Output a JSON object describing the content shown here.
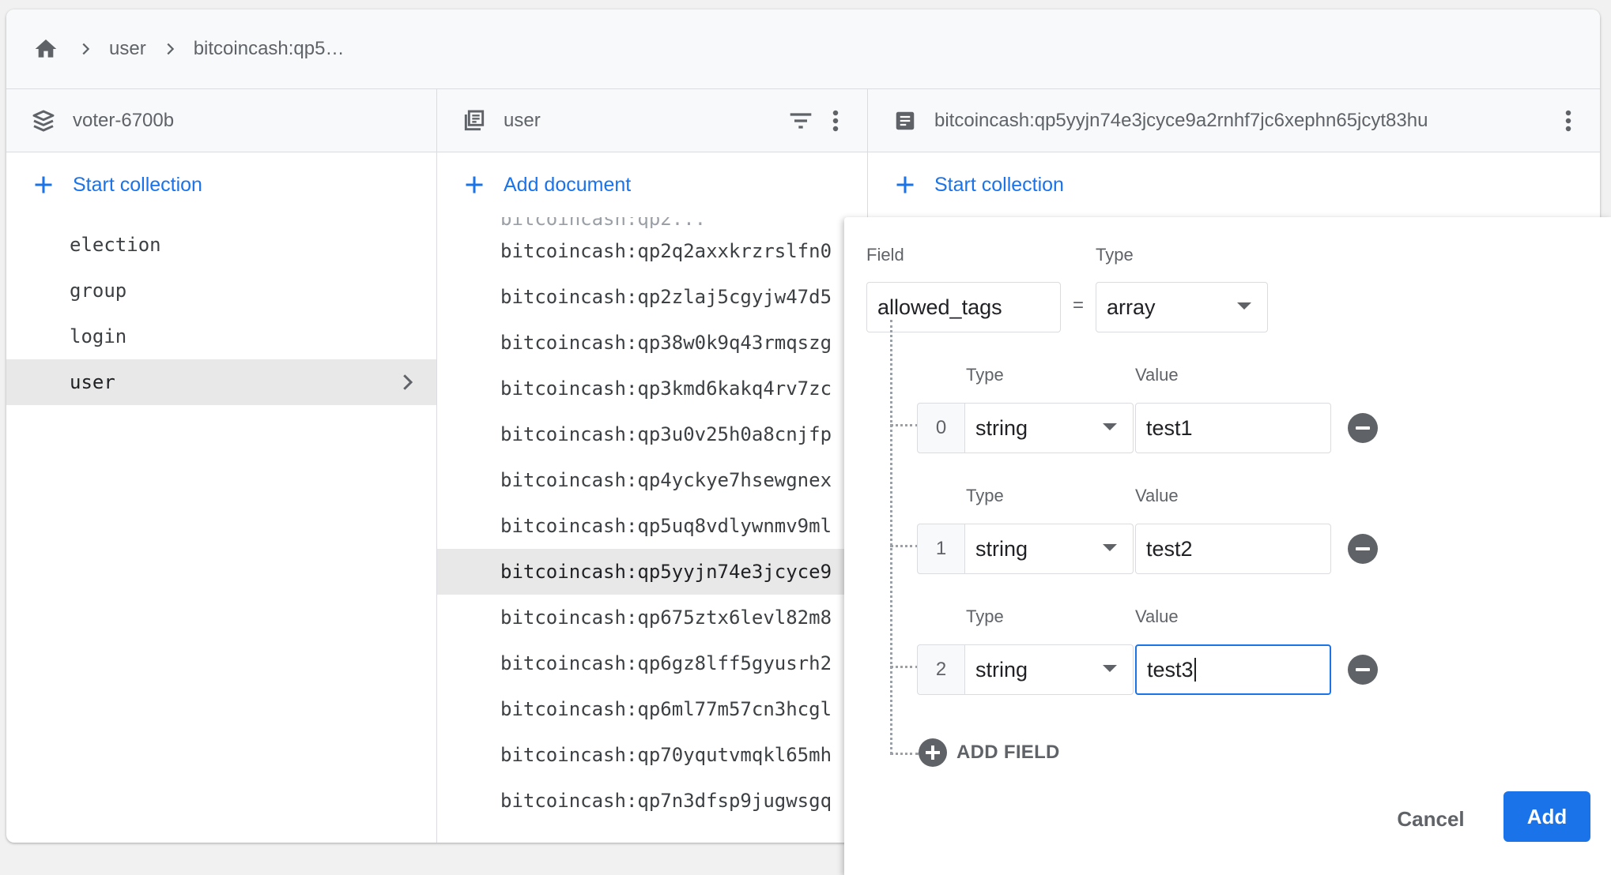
{
  "breadcrumb": {
    "items": [
      "user",
      "bitcoincash:qp5…"
    ]
  },
  "columns": {
    "project": {
      "title": "voter-6700b",
      "add_label": "Start collection",
      "items": [
        "election",
        "group",
        "login",
        "user"
      ],
      "selected": "user"
    },
    "collection": {
      "title": "user",
      "add_label": "Add document",
      "cut_item": "bitcoincash:qp2...",
      "items": [
        "bitcoincash:qp2q2axxkrzrslfn0",
        "bitcoincash:qp2zlaj5cgyjw47d5",
        "bitcoincash:qp38w0k9q43rmqszg",
        "bitcoincash:qp3kmd6kakq4rv7zc",
        "bitcoincash:qp3u0v25h0a8cnjfp",
        "bitcoincash:qp4yckye7hsewgnex",
        "bitcoincash:qp5uq8vdlywnmv9ml",
        "bitcoincash:qp5yyjn74e3jcyce9",
        "bitcoincash:qp675ztx6levl82m8",
        "bitcoincash:qp6gz8lff5gyusrh2",
        "bitcoincash:qp6ml77m57cn3hcgl",
        "bitcoincash:qp70yqutvmqkl65mh",
        "bitcoincash:qp7n3dfsp9jugwsgq"
      ],
      "selected_index": 7
    },
    "document": {
      "title": "bitcoincash:qp5yyjn74e3jcyce9a2rnhf7jc6xephn65jcyt83hu",
      "add_label": "Start collection"
    }
  },
  "panel": {
    "field_label": "Field",
    "type_label": "Type",
    "value_label": "Value",
    "field_value": "allowed_tags",
    "equals": "=",
    "field_type": "array",
    "elements": [
      {
        "index": "0",
        "type": "string",
        "value": "test1"
      },
      {
        "index": "1",
        "type": "string",
        "value": "test2"
      },
      {
        "index": "2",
        "type": "string",
        "value": "test3"
      }
    ],
    "add_field_label": "ADD FIELD",
    "cancel_label": "Cancel",
    "add_label": "Add"
  },
  "colors": {
    "accent": "#1a73e8",
    "selected_row": "#e8e8e8",
    "icon_gray": "#5f6368"
  }
}
